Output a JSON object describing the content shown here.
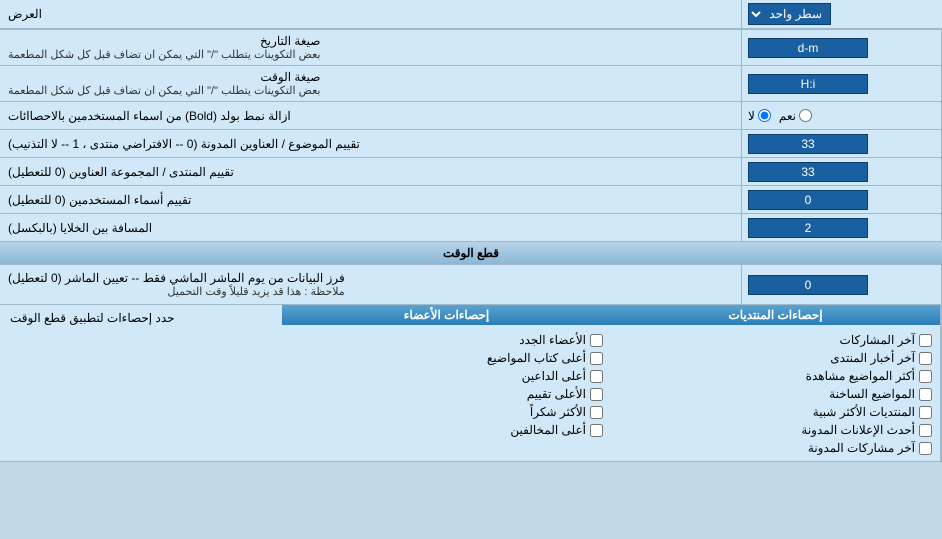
{
  "header": {
    "display_label": "العرض",
    "select_label": "سطر واحد"
  },
  "date_format": {
    "label": "صيغة التاريخ",
    "sublabel": "بعض التكوينات يتطلب \"/\" التي يمكن ان تضاف قبل كل شكل المطعمة",
    "value": "d-m"
  },
  "time_format": {
    "label": "صيغة الوقت",
    "sublabel": "بعض التكوينات يتطلب \"/\" التي يمكن ان تضاف قبل كل شكل المطعمة",
    "value": "H:i"
  },
  "bold_remove": {
    "label": "ازالة نمط بولد (Bold) من اسماء المستخدمين بالاحصاائات",
    "option_yes": "نعم",
    "option_no": "لا",
    "selected": "no"
  },
  "topic_order": {
    "label": "تقييم الموضوع / العناوين المدونة (0 -- الافتراضي منتدى ، 1 -- لا التذنيب)",
    "value": "33"
  },
  "forum_order": {
    "label": "تقييم المنتدى / المجموعة العناوين (0 للتعطيل)",
    "value": "33"
  },
  "username_order": {
    "label": "تقييم أسماء المستخدمين (0 للتعطيل)",
    "value": "0"
  },
  "cell_spacing": {
    "label": "المسافة بين الخلايا (بالبكسل)",
    "value": "2"
  },
  "cutoff_section": {
    "title": "قطع الوقت"
  },
  "cutoff_days": {
    "label": "فرز البيانات من يوم الماشر الماشي فقط -- تعيين الماشر (0 لتعطيل)",
    "note": "ملاحظة : هذا قد يزيد قليلاً وقت التحميل",
    "value": "0"
  },
  "stats_limits": {
    "label": "حدد إحصاءات لتطبيق قطع الوقت"
  },
  "stats_posts_title": "إحصاءات المنتديات",
  "stats_members_title": "إحصاءات الأعضاء",
  "posts_checkboxes": [
    {
      "label": "آخر المشاركات",
      "checked": false
    },
    {
      "label": "آخر أخبار المنتدى",
      "checked": false
    },
    {
      "label": "أكثر المواضيع مشاهدة",
      "checked": false
    },
    {
      "label": "المواضيع الساخنة",
      "checked": false
    },
    {
      "label": "المنتديات الأكثر شبية",
      "checked": false
    },
    {
      "label": "أحدث الإعلانات المدونة",
      "checked": false
    },
    {
      "label": "آخر مشاركات المدونة",
      "checked": false
    }
  ],
  "members_checkboxes": [
    {
      "label": "الأعضاء الجدد",
      "checked": false
    },
    {
      "label": "أعلى كتاب المواضيع",
      "checked": false
    },
    {
      "label": "أعلى الداعين",
      "checked": false
    },
    {
      "label": "الأعلى تقييم",
      "checked": false
    },
    {
      "label": "الأكثر شكراً",
      "checked": false
    },
    {
      "label": "أعلى المخالفين",
      "checked": false
    }
  ]
}
